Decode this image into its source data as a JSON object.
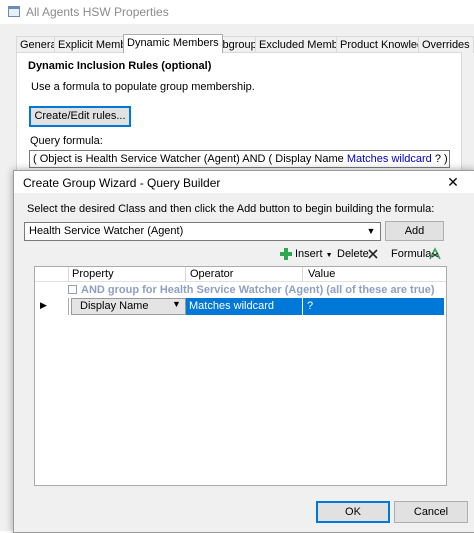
{
  "background_window": {
    "title": "All Agents HSW Properties",
    "tabs": [
      "General",
      "Explicit Members",
      "Dynamic Members",
      "Subgroups",
      "Excluded Members",
      "Product Knowledge",
      "Overrides"
    ],
    "active_tab": "Dynamic Members",
    "section_heading": "Dynamic Inclusion Rules (optional)",
    "description": "Use a formula to populate group membership.",
    "create_edit_button": "Create/Edit rules...",
    "query_formula_label": "Query formula:",
    "query_formula": {
      "prefix": "( Object is Health Service Watcher (Agent) AND ( Display Name ",
      "highlight": "Matches wildcard",
      "suffix": " ? ) AND True )"
    }
  },
  "wizard": {
    "title": "Create Group Wizard - Query Builder",
    "close_glyph": "✕",
    "instruction": "Select the desired Class and then click the Add button to begin building the formula:",
    "class_select_value": "Health Service Watcher (Agent)",
    "add_button": "Add",
    "toolbar": {
      "insert": "Insert",
      "delete": "Delete",
      "formula": "Formula"
    },
    "grid": {
      "columns": [
        "Property",
        "Operator",
        "Value"
      ],
      "group_row": "AND group for Health Service Watcher (Agent) (all of these are true)",
      "rows": [
        {
          "property": "Display Name",
          "operator": "Matches wildcard",
          "value": "?"
        }
      ]
    },
    "ok_button": "OK",
    "cancel_button": "Cancel"
  },
  "colors": {
    "selection": "#0078d7",
    "group_text": "#8e9fc4",
    "highlight_text": "#0000cc"
  },
  "icons": [
    "window-icon",
    "insert-plus-icon",
    "delete-x-icon",
    "formula-icon",
    "close-icon",
    "dropdown-arrow-icon",
    "row-pointer-icon"
  ]
}
